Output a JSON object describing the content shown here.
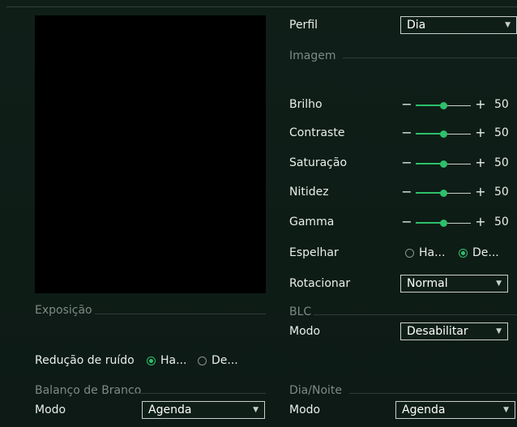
{
  "profile": {
    "label": "Perfil",
    "value": "Dia"
  },
  "image": {
    "section": "Imagem",
    "sliders": [
      {
        "label": "Brilho",
        "value": "50"
      },
      {
        "label": "Contraste",
        "value": "50"
      },
      {
        "label": "Saturação",
        "value": "50"
      },
      {
        "label": "Nitidez",
        "value": "50"
      },
      {
        "label": "Gamma",
        "value": "50"
      }
    ],
    "slider_level": 0.5,
    "mirror": {
      "label": "Espelhar",
      "opt1": "Ha...",
      "opt2": "De...",
      "selected": "opt2"
    },
    "rotate": {
      "label": "Rotacionar",
      "value": "Normal"
    }
  },
  "exposure": {
    "section": "Exposição"
  },
  "blc": {
    "section": "BLC",
    "mode_label": "Modo",
    "mode_value": "Desabilitar"
  },
  "noise": {
    "label": "Redução de ruído",
    "opt1": "Ha...",
    "opt2": "De...",
    "selected": "opt1"
  },
  "white_balance": {
    "section": "Balanço de Branco",
    "mode_label": "Modo",
    "mode_value": "Agenda"
  },
  "day_night": {
    "section": "Dia/Noite",
    "mode_label": "Modo",
    "mode_value": "Agenda"
  },
  "colors": {
    "accent": "#2ec06a",
    "background": "#0e1c16"
  }
}
